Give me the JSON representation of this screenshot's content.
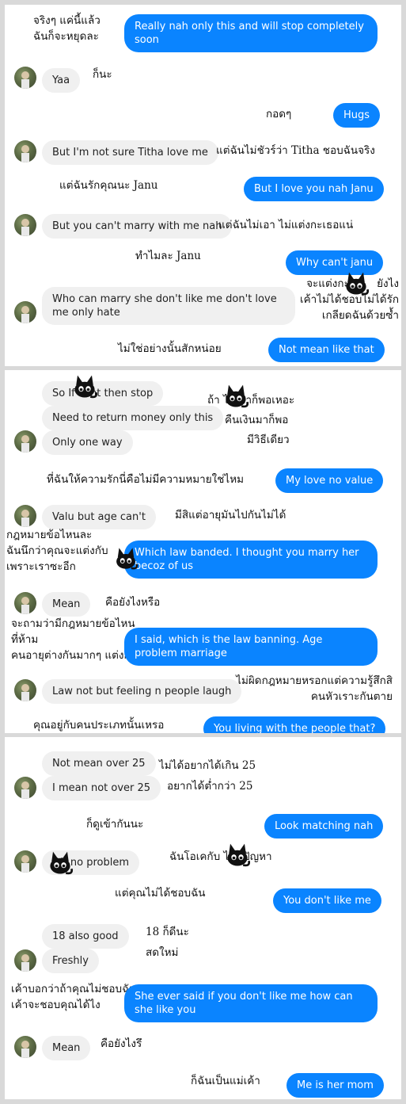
{
  "panel1": {
    "translations": {
      "really_nah": "จริงๆ แค่นี้แล้ว\nฉันก็จะหยุดละ",
      "yaa": "ก็นะ",
      "hugs": "กอดๆ",
      "not_sure": "แต่ฉันไม่ชัวร์ว่า Titha ชอบฉันจริง",
      "i_love": "แต่ฉันรักคุณนะ Janu",
      "cant_marry": "แต่ฉันไม่เอา ไม่แต่งกะเธอแน่",
      "why": "ทำไมละ Janu",
      "who_marry": "จะแต่งกะ        ยังไง\nเค้าไม่ได้ชอบไม่ได้รัก\nเกลียดฉันด้วยซ้ำ",
      "not_mean": "ไม่ใช่อย่างนั้นสักหน่อย"
    },
    "messages": {
      "really_nah": "Really nah only this and will stop completely soon",
      "yaa": "Yaa",
      "hugs": "Hugs",
      "not_sure": "But I'm not sure Titha love me",
      "i_love": "But I love you nah Janu",
      "cant_marry": "But you can't marry with me nah",
      "why": "Why can't janu",
      "who_marry": "Who can marry she don't like me don't love me only hate",
      "not_mean": "Not mean like that"
    }
  },
  "panel2": {
    "translations": {
      "so_if": "ถ้า        ไม่เอาก็พอเหอะ",
      "return_money": "คืนเงินมาก็พอ",
      "one_way": "มีวิธีเดียว",
      "love_no_value": "ที่ฉันให้ความรักนี่คือไม่มีความหมายใช่ไหม",
      "valu": "มีสิแต่อายุมันไปกันไม่ได้",
      "which_law": "กฎหมายข้อไหนละ\nฉันนึกว่าคุณจะแต่งกับ\nเพราะเราซะอีก",
      "mean": "คือยังไงหรือ",
      "i_said": "จะถามว่ามีกฎหมายข้อไหน\nที่ห้าม\nคนอายุต่างกันมากๆ แต่งกัน",
      "law_not": "ไม่ผิดกฎหมายหรอกแต่ความรู้สึกสิ\nคนหัวเราะกันตาย",
      "you_living": "คุณอยู่กับคนประเภทนั้นเหรอ"
    },
    "messages": {
      "so_if": "So If        cant then stop",
      "return_money": "Need to return money only this",
      "one_way": "Only one way",
      "love_no_value": "My love no value",
      "valu": "Valu but age can't",
      "which_law": "Which law banded. I thought you marry her becoz of us",
      "mean": "Mean",
      "i_said": "I said, which is the law banning. Age problem marriage",
      "law_not": "Law not but feeling  n people laugh",
      "you_living": "You living with the people that?"
    }
  },
  "panel3": {
    "translations": {
      "not_over": "ไม่ได้อยากได้เกิน 25",
      "mean_over": "อยากได้ต่ำกว่า 25",
      "matching": "ก็ดูเข้ากันนะ",
      "ok_problem": "ฉันโอเคกับ        ไม่มีปัญหา",
      "dont_like": "แต่คุณไม่ได้ชอบฉัน",
      "eighteen": "18 ก็ดีนะ",
      "freshly": "สดใหม่",
      "she_said": "เค้าบอกว่าถ้าคุณไม่ชอบฉัน\nเค้าจะชอบคุณได้ไง",
      "mean": "คือยังไงรึ",
      "mom": "ก็ฉันเป็นแม่เค้า"
    },
    "messages": {
      "not_over": "Not mean over 25",
      "mean_over": "I mean not over 25",
      "matching": "Look matching nah",
      "ok_problem": "       OK no problem",
      "dont_like": "You don't like me",
      "eighteen": "18 also good",
      "freshly": "Freshly",
      "she_said": "She ever said if you don't like me how can she like you",
      "mean": "Mean",
      "mom": "Me is her mom"
    }
  },
  "colors": {
    "outgoing": "#0a84ff",
    "incoming": "#f0f0f0",
    "frame": "#d9d9d9"
  },
  "icons": {
    "sticker": "black-cat-sticker-icon",
    "avatar": "contact-avatar-icon"
  }
}
